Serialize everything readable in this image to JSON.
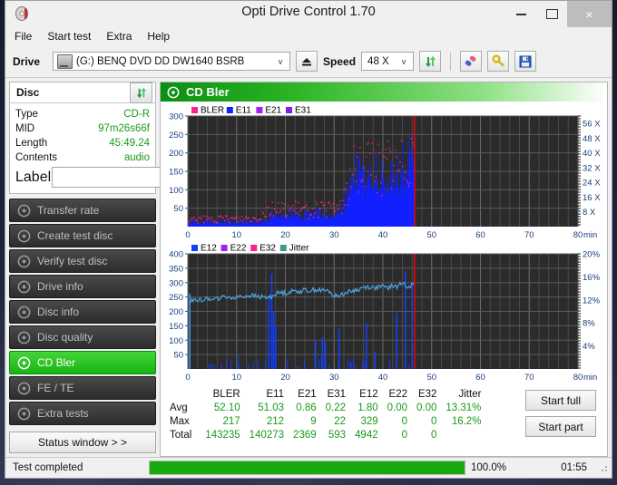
{
  "window": {
    "title": "Opti Drive Control 1.70",
    "app_icon": "disc-icon",
    "minimize": "minimize-icon",
    "maximize": "maximize-icon",
    "close": "×"
  },
  "menu": [
    "File",
    "Start test",
    "Extra",
    "Help"
  ],
  "toolbar": {
    "drive_label": "Drive",
    "drive_value": "(G:)   BENQ DVD DD DW1640 BSRB",
    "eject_icon": "eject-icon",
    "speed_label": "Speed",
    "speed_value": "48 X",
    "refresh_icon": "refresh-icon",
    "erase_icon": "erase-icon",
    "key_icon": "key-icon",
    "save_icon": "save-icon",
    "chevron": "v"
  },
  "disc": {
    "header": "Disc",
    "refresh_icon": "refresh-icon",
    "rows": [
      {
        "key": "Type",
        "value": "CD-R"
      },
      {
        "key": "MID",
        "value": "97m26s66f"
      },
      {
        "key": "Length",
        "value": "45:49.24"
      },
      {
        "key": "Contents",
        "value": "audio"
      }
    ],
    "label_key": "Label",
    "label_value": "",
    "label_placeholder": "",
    "disc_button_icon": "cd-icon"
  },
  "nav": {
    "items": [
      {
        "label": "Transfer rate",
        "icon": "disc-icon",
        "active": false
      },
      {
        "label": "Create test disc",
        "icon": "disc-write-icon",
        "active": false
      },
      {
        "label": "Verify test disc",
        "icon": "disc-check-icon",
        "active": false
      },
      {
        "label": "Drive info",
        "icon": "drive-info-icon",
        "active": false
      },
      {
        "label": "Disc info",
        "icon": "disc-info-icon",
        "active": false
      },
      {
        "label": "Disc quality",
        "icon": "disc-quality-icon",
        "active": false
      },
      {
        "label": "CD Bler",
        "icon": "disc-bler-icon",
        "active": true
      },
      {
        "label": "FE / TE",
        "icon": "disc-fete-icon",
        "active": false
      },
      {
        "label": "Extra tests",
        "icon": "disc-extra-icon",
        "active": false
      }
    ],
    "status_window": "Status window > >"
  },
  "panel": {
    "title": "CD Bler",
    "icon": "disc-icon"
  },
  "chart_data": [
    {
      "type": "area",
      "title": "CD Bler",
      "xlabel": "min",
      "ylabel": "",
      "xlim": [
        0,
        80
      ],
      "ylim": [
        0,
        300
      ],
      "xticks": [
        0,
        10,
        20,
        30,
        40,
        50,
        60,
        70,
        80
      ],
      "xtick_labels": [
        "0",
        "10",
        "20",
        "30",
        "40",
        "50",
        "60",
        "70",
        "80"
      ],
      "yticks": [
        50,
        100,
        150,
        200,
        250,
        300
      ],
      "ytick_labels": [
        "50",
        "100",
        "150",
        "200",
        "250",
        "300"
      ],
      "y2ticks": [
        8,
        16,
        24,
        32,
        40,
        48,
        56
      ],
      "y2tick_labels": [
        "8 X",
        "16 X",
        "24 X",
        "32 X",
        "40 X",
        "48 X",
        "56 X"
      ],
      "y2lim": [
        0,
        60
      ],
      "grid": true,
      "legend_position": "top-left",
      "background": "#2b2b2b",
      "data_end_marker_x": 46.5,
      "marker_color": "#ff0000",
      "legend": [
        {
          "name": "BLER",
          "color": "#ff2090"
        },
        {
          "name": "E11",
          "color": "#1020ff"
        },
        {
          "name": "E21",
          "color": "#a020f0"
        },
        {
          "name": "E31",
          "color": "#8020e0"
        }
      ],
      "series": [
        {
          "name": "E11",
          "color": "#1020ff",
          "x": [
            0.3,
            1,
            2,
            3,
            4,
            5,
            6,
            7,
            8,
            9,
            10,
            11,
            12,
            13,
            14,
            15,
            16,
            16.5,
            17,
            18,
            19,
            20,
            21,
            22,
            23,
            24,
            25,
            26,
            27,
            28,
            29,
            30,
            31,
            32,
            33,
            34,
            34.5,
            35,
            35.5,
            36,
            36.5,
            37,
            37.5,
            38,
            38.5,
            39,
            39.5,
            40,
            40.5,
            41,
            41.5,
            42,
            42.5,
            43,
            43.5,
            44,
            44.5,
            45,
            45.5,
            46,
            46.4
          ],
          "y": [
            12,
            14,
            12,
            13,
            15,
            12,
            14,
            13,
            16,
            14,
            13,
            15,
            14,
            16,
            15,
            14,
            18,
            22,
            30,
            34,
            38,
            35,
            33,
            36,
            34,
            30,
            34,
            38,
            36,
            34,
            30,
            35,
            45,
            60,
            95,
            130,
            155,
            140,
            160,
            130,
            120,
            150,
            125,
            135,
            160,
            130,
            115,
            135,
            150,
            120,
            125,
            135,
            115,
            130,
            150,
            175,
            140,
            155,
            190,
            205,
            215
          ]
        },
        {
          "name": "BLER",
          "color": "#ff2090",
          "x": [
            0.3,
            2,
            4,
            6,
            8,
            10,
            12,
            14,
            16,
            17,
            18,
            19,
            20,
            21,
            22,
            23,
            24,
            26,
            28,
            30,
            32,
            33,
            34,
            35,
            36,
            37,
            38,
            39,
            40,
            41,
            42,
            43,
            44,
            45,
            45.5,
            46,
            46.4
          ],
          "y": [
            18,
            20,
            22,
            20,
            24,
            22,
            25,
            24,
            46,
            52,
            48,
            44,
            50,
            46,
            48,
            44,
            42,
            48,
            46,
            45,
            70,
            105,
            150,
            175,
            160,
            170,
            185,
            155,
            150,
            170,
            160,
            155,
            175,
            195,
            215,
            220,
            225
          ]
        }
      ]
    },
    {
      "type": "line",
      "title": "",
      "xlabel": "min",
      "xlim": [
        0,
        80
      ],
      "ylim": [
        0,
        400
      ],
      "xticks": [
        0,
        10,
        20,
        30,
        40,
        50,
        60,
        70,
        80
      ],
      "xtick_labels": [
        "0",
        "10",
        "20",
        "30",
        "40",
        "50",
        "60",
        "70",
        "80"
      ],
      "yticks": [
        50,
        100,
        150,
        200,
        250,
        300,
        350,
        400
      ],
      "ytick_labels": [
        "50",
        "100",
        "150",
        "200",
        "250",
        "300",
        "350",
        "400"
      ],
      "y2ticks": [
        4,
        8,
        12,
        16,
        20
      ],
      "y2tick_labels": [
        "4%",
        "8%",
        "12%",
        "16%",
        "20%"
      ],
      "y2lim": [
        0,
        20
      ],
      "grid": true,
      "legend_position": "top-left",
      "background": "#2b2b2b",
      "data_end_marker_x": 46.5,
      "marker_color": "#ff0000",
      "legend": [
        {
          "name": "E12",
          "color": "#1040ff"
        },
        {
          "name": "E22",
          "color": "#a020f0"
        },
        {
          "name": "E32",
          "color": "#ff2090"
        },
        {
          "name": "Jitter",
          "color": "#3f9c8c"
        }
      ],
      "series": [
        {
          "name": "Jitter",
          "color": "#4aa3df",
          "x": [
            0.4,
            1,
            2,
            3,
            4,
            5,
            6,
            7,
            8,
            9,
            10,
            11,
            12,
            13,
            14,
            15,
            16,
            17,
            18,
            19,
            20,
            21,
            22,
            23,
            24,
            25,
            26,
            27,
            28,
            29,
            30,
            31,
            32,
            33,
            34,
            35,
            36,
            37,
            38,
            39,
            40,
            41,
            42,
            43,
            44,
            45,
            46,
            46.4
          ],
          "y": [
            232,
            238,
            242,
            240,
            244,
            246,
            243,
            248,
            250,
            247,
            252,
            250,
            254,
            256,
            252,
            250,
            248,
            250,
            262,
            266,
            264,
            268,
            272,
            270,
            274,
            272,
            276,
            274,
            272,
            270,
            252,
            256,
            262,
            268,
            272,
            276,
            284,
            286,
            282,
            284,
            286,
            282,
            288,
            286,
            300,
            288,
            292,
            296
          ]
        },
        {
          "name": "E12-spikes",
          "color": "#1040ff",
          "x": [
            0.4,
            10.5,
            16.6,
            17.2,
            17.6,
            18.0,
            22.6,
            26.2,
            27.6,
            28.2,
            31.0,
            33.4,
            36.6,
            38.4,
            42.8,
            44.6,
            46.0
          ],
          "y": [
            262,
            10,
            250,
            332,
            200,
            150,
            8,
            100,
            110,
            95,
            140,
            25,
            160,
            60,
            195,
            340,
            300
          ]
        }
      ]
    }
  ],
  "stats": {
    "columns": [
      "BLER",
      "E11",
      "E21",
      "E31",
      "E12",
      "E22",
      "E32",
      "Jitter"
    ],
    "rows": [
      {
        "label": "Avg",
        "values": [
          "52.10",
          "51.03",
          "0.86",
          "0.22",
          "1.80",
          "0.00",
          "0.00",
          "13.31%"
        ]
      },
      {
        "label": "Max",
        "values": [
          "217",
          "212",
          "9",
          "22",
          "329",
          "0",
          "0",
          "16.2%"
        ]
      },
      {
        "label": "Total",
        "values": [
          "143235",
          "140273",
          "2369",
          "593",
          "4942",
          "0",
          "0",
          ""
        ]
      }
    ]
  },
  "actions": {
    "start_full": "Start full",
    "start_part": "Start part"
  },
  "statusbar": {
    "text": "Test completed",
    "percent": "100.0%",
    "progress": 100,
    "time": "01:55"
  },
  "colors": {
    "accent_green": "#16aa0d",
    "value_green": "#1a9a1a",
    "chart_bg": "#2b2b2b",
    "marker_red": "#ff0000"
  }
}
